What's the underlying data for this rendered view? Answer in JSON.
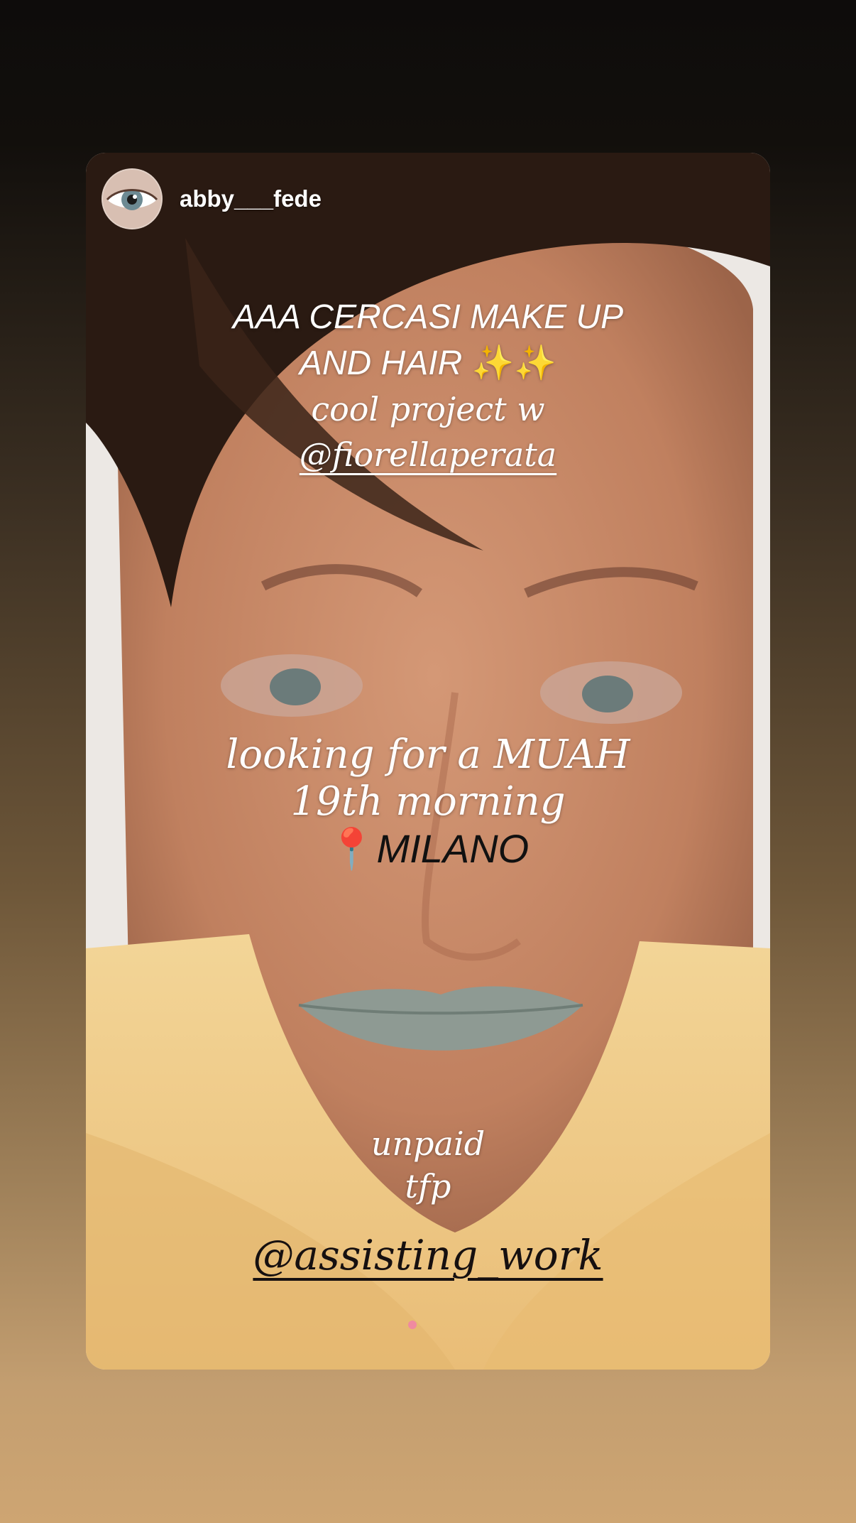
{
  "story": {
    "username": "abby___fede",
    "avatar_icon": "eye-avatar-icon",
    "text_block_1": {
      "line1": "AAA CERCASI MAKE UP",
      "line2": "AND HAIR",
      "line2_emoji": "✨✨",
      "line3": "cool project w",
      "line4": "@fiorellaperata"
    },
    "text_block_2": {
      "line1": "looking for a MUAH",
      "line2": "19th morning",
      "line3_icon": "📍",
      "line3": "MILANO"
    },
    "text_block_3": {
      "line1": "unpaid",
      "line2": "tfp"
    },
    "mention": "@assisting_work"
  },
  "colors": {
    "background_top": "#0e0c0b",
    "background_bottom": "#cea572",
    "text": "#ffffff",
    "dark_text": "#161010"
  }
}
